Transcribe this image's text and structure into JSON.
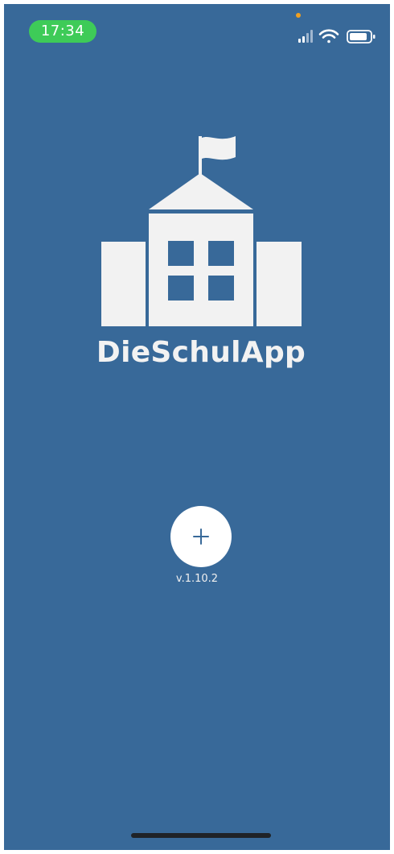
{
  "status_bar": {
    "time": "17:34",
    "icons": [
      "cellular-signal-icon",
      "wifi-icon",
      "battery-icon"
    ]
  },
  "app": {
    "title": "DieSchulApp",
    "logo_icon": "school-building-icon",
    "version": "v.1.10.2"
  },
  "actions": {
    "add_icon": "plus-icon"
  },
  "colors": {
    "background": "#386999",
    "logo": "#f2f2f2",
    "time_pill": "#3ecb58",
    "privacy_dot": "#f0a020"
  }
}
